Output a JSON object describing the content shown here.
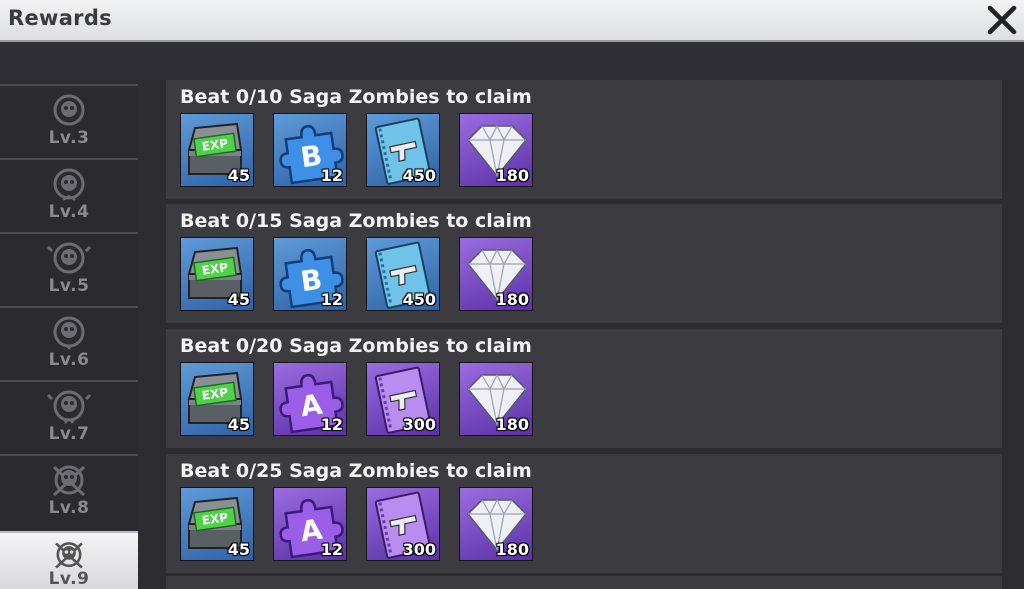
{
  "header": {
    "title": "Rewards"
  },
  "sidebar": {
    "levels": [
      {
        "label": "Lv.3"
      },
      {
        "label": "Lv.4"
      },
      {
        "label": "Lv.5"
      },
      {
        "label": "Lv.6"
      },
      {
        "label": "Lv.7"
      },
      {
        "label": "Lv.8"
      },
      {
        "label": "Lv.9",
        "selected": true
      }
    ]
  },
  "rewards_list": [
    {
      "title": "Beat 0/10 Saga Zombies to claim",
      "items": [
        {
          "icon": "exp-chest-icon",
          "rarity": "blue",
          "count": "45"
        },
        {
          "icon": "puzzle-b-icon",
          "rarity": "blue",
          "count": "12"
        },
        {
          "icon": "gun-manual-icon",
          "rarity": "blue",
          "count": "450"
        },
        {
          "icon": "diamond-icon",
          "rarity": "purple",
          "count": "180"
        }
      ]
    },
    {
      "title": "Beat 0/15 Saga Zombies to claim",
      "items": [
        {
          "icon": "exp-chest-icon",
          "rarity": "blue",
          "count": "45"
        },
        {
          "icon": "puzzle-b-icon",
          "rarity": "blue",
          "count": "12"
        },
        {
          "icon": "gun-manual-icon",
          "rarity": "blue",
          "count": "450"
        },
        {
          "icon": "diamond-icon",
          "rarity": "purple",
          "count": "180"
        }
      ]
    },
    {
      "title": "Beat 0/20 Saga Zombies to claim",
      "items": [
        {
          "icon": "exp-chest-icon",
          "rarity": "blue",
          "count": "45"
        },
        {
          "icon": "puzzle-a-icon",
          "rarity": "purple",
          "count": "12"
        },
        {
          "icon": "gun-manual-icon",
          "rarity": "purple",
          "count": "300"
        },
        {
          "icon": "diamond-icon",
          "rarity": "purple",
          "count": "180"
        }
      ]
    },
    {
      "title": "Beat 0/25 Saga Zombies to claim",
      "items": [
        {
          "icon": "exp-chest-icon",
          "rarity": "blue",
          "count": "45"
        },
        {
          "icon": "puzzle-a-icon",
          "rarity": "purple",
          "count": "12"
        },
        {
          "icon": "gun-manual-icon",
          "rarity": "purple",
          "count": "300"
        },
        {
          "icon": "diamond-icon",
          "rarity": "purple",
          "count": "180"
        }
      ]
    }
  ],
  "colors": {
    "rarity_blue": "#3f7cc4",
    "rarity_purple": "#7445c4",
    "panel_bg": "#3b3b40",
    "page_bg": "#2c2c31"
  }
}
